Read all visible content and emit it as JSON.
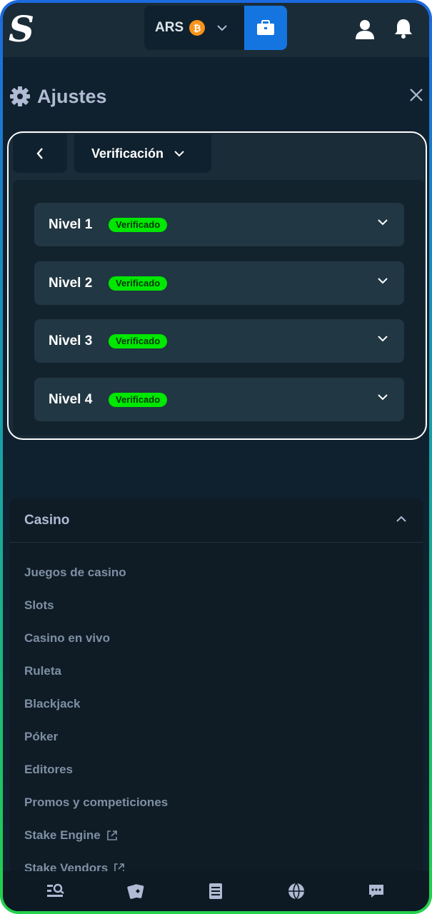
{
  "header": {
    "logo_letter": "S",
    "currency": "ARS",
    "coin_symbol": "₿"
  },
  "settings": {
    "title": "Ajustes"
  },
  "verification": {
    "section_label": "Verificación",
    "levels": [
      {
        "label": "Nivel 1",
        "status": "Verificado"
      },
      {
        "label": "Nivel 2",
        "status": "Verificado"
      },
      {
        "label": "Nivel 3",
        "status": "Verificado"
      },
      {
        "label": "Nivel 4",
        "status": "Verificado"
      }
    ]
  },
  "casino_menu": {
    "title": "Casino",
    "items": [
      {
        "label": "Juegos de casino"
      },
      {
        "label": "Slots"
      },
      {
        "label": "Casino en vivo"
      },
      {
        "label": "Ruleta"
      },
      {
        "label": "Blackjack"
      },
      {
        "label": "Póker"
      },
      {
        "label": "Editores"
      },
      {
        "label": "Promos y competiciones"
      },
      {
        "label": "Stake Engine"
      },
      {
        "label": "Stake Vendors"
      }
    ]
  },
  "colors": {
    "accent_blue": "#1475e1",
    "badge_green": "#00e701",
    "bg_dark": "#0f212e",
    "panel": "#213743"
  },
  "icons": {
    "bottom_nav": [
      "browse-icon",
      "casino-cards-icon",
      "bets-list-icon",
      "sports-ball-icon",
      "chat-icon"
    ]
  }
}
